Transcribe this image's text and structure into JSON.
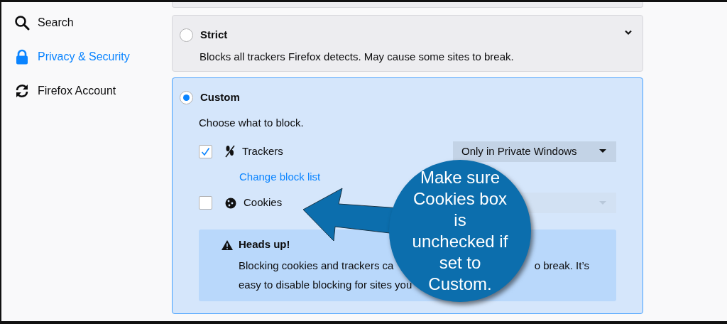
{
  "sidebar": {
    "items": [
      {
        "label": "Search",
        "selected": false
      },
      {
        "label": "Privacy & Security",
        "selected": true
      },
      {
        "label": "Firefox Account",
        "selected": false
      }
    ]
  },
  "blocking_options": [
    {
      "title": "Strict",
      "selected": false,
      "expanded": false,
      "description": "Blocks all trackers Firefox detects. May cause some sites to break."
    },
    {
      "title": "Custom",
      "selected": true,
      "expanded": true,
      "prompt": "Choose what to block.",
      "rows": [
        {
          "label": "Trackers",
          "checked": true,
          "dropdown": {
            "value": "Only in Private Windows",
            "disabled": false
          },
          "link": "Change block list"
        },
        {
          "label": "Cookies",
          "checked": false,
          "dropdown": {
            "disabled": true
          }
        }
      ],
      "warning": {
        "title": "Heads up!",
        "line_1_left": "Blocking cookies and trackers ca",
        "line_1_right": "o break. It’s",
        "line_2": "easy to disable blocking for sites you"
      }
    }
  ],
  "callout": {
    "text": "Make sure Cookies box is unchecked if set to Custom."
  }
}
